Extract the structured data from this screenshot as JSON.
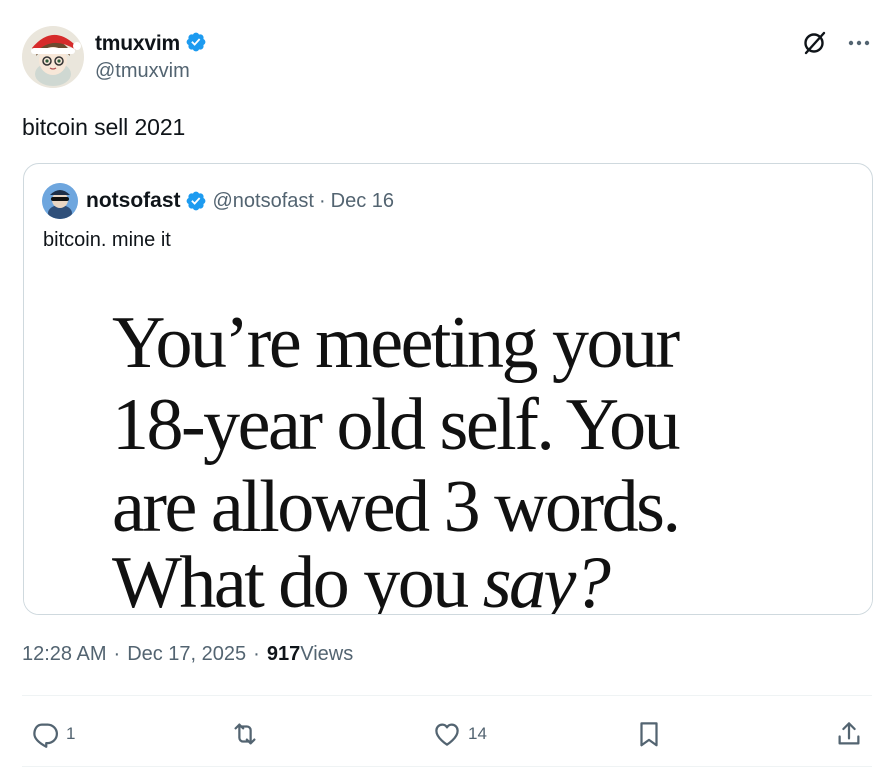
{
  "tweet": {
    "author": {
      "display_name": "tmuxvim",
      "handle": "@tmuxvim",
      "verified": true
    },
    "text": "bitcoin sell 2021",
    "quoted": {
      "author": {
        "display_name": "notsofast",
        "handle": "@notsofast",
        "verified": true
      },
      "separator": "·",
      "date": "Dec 16",
      "text": "bitcoin. mine it",
      "image_text": {
        "line1": "You’re meeting your",
        "line2": "18-year old self. You",
        "line3": "are allowed 3 words.",
        "line4_main": "What do you ",
        "line4_italic": "say?"
      }
    },
    "meta": {
      "time": "12:28 AM",
      "sep1": "·",
      "date": "Dec 17, 2025",
      "sep2": "·",
      "views_count": "917",
      "views_label": " Views"
    },
    "actions": {
      "replies": "1",
      "reposts": "",
      "likes": "14"
    }
  },
  "colors": {
    "text_primary": "#0f1419",
    "text_secondary": "#536471",
    "verified_blue": "#1d9bf0",
    "border": "#cfd9de",
    "divider": "#eff3f4"
  },
  "icons": {
    "verified": "verified-badge-icon",
    "grok": "grok-icon",
    "more": "more-icon",
    "reply": "reply-icon",
    "repost": "repost-icon",
    "like": "like-icon",
    "bookmark": "bookmark-icon",
    "share": "share-icon"
  }
}
